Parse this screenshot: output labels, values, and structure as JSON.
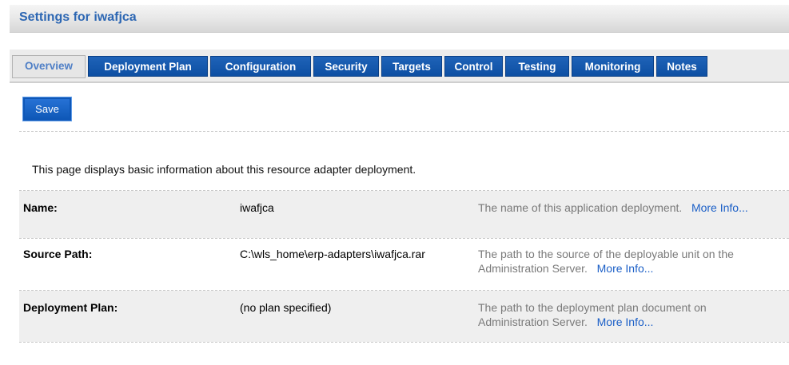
{
  "header": {
    "title": "Settings for iwafjca"
  },
  "tabs": [
    {
      "label": "Overview",
      "active": true
    },
    {
      "label": "Deployment Plan"
    },
    {
      "label": "Configuration"
    },
    {
      "label": "Security"
    },
    {
      "label": "Targets"
    },
    {
      "label": "Control"
    },
    {
      "label": "Testing"
    },
    {
      "label": "Monitoring"
    },
    {
      "label": "Notes"
    }
  ],
  "toolbar": {
    "save_label": "Save"
  },
  "intro": "This page displays basic information about this resource adapter deployment.",
  "rows": [
    {
      "label": "Name:",
      "value": "iwafjca",
      "description": "The name of this application deployment.",
      "more": "More Info..."
    },
    {
      "label": "Source Path:",
      "value": "C:\\wls_home\\erp-adapters\\iwafjca.rar",
      "description": "The path to the source of the deployable unit on the Administration Server.",
      "more": "More Info..."
    },
    {
      "label": "Deployment Plan:",
      "value": "(no plan specified)",
      "description": "The path to the deployment plan document on Administration Server.",
      "more": "More Info..."
    }
  ],
  "colors": {
    "accent": "#0d56b5",
    "title": "#2d67b3",
    "link": "#1b5fc7",
    "muted_text": "#7a7a7a"
  }
}
